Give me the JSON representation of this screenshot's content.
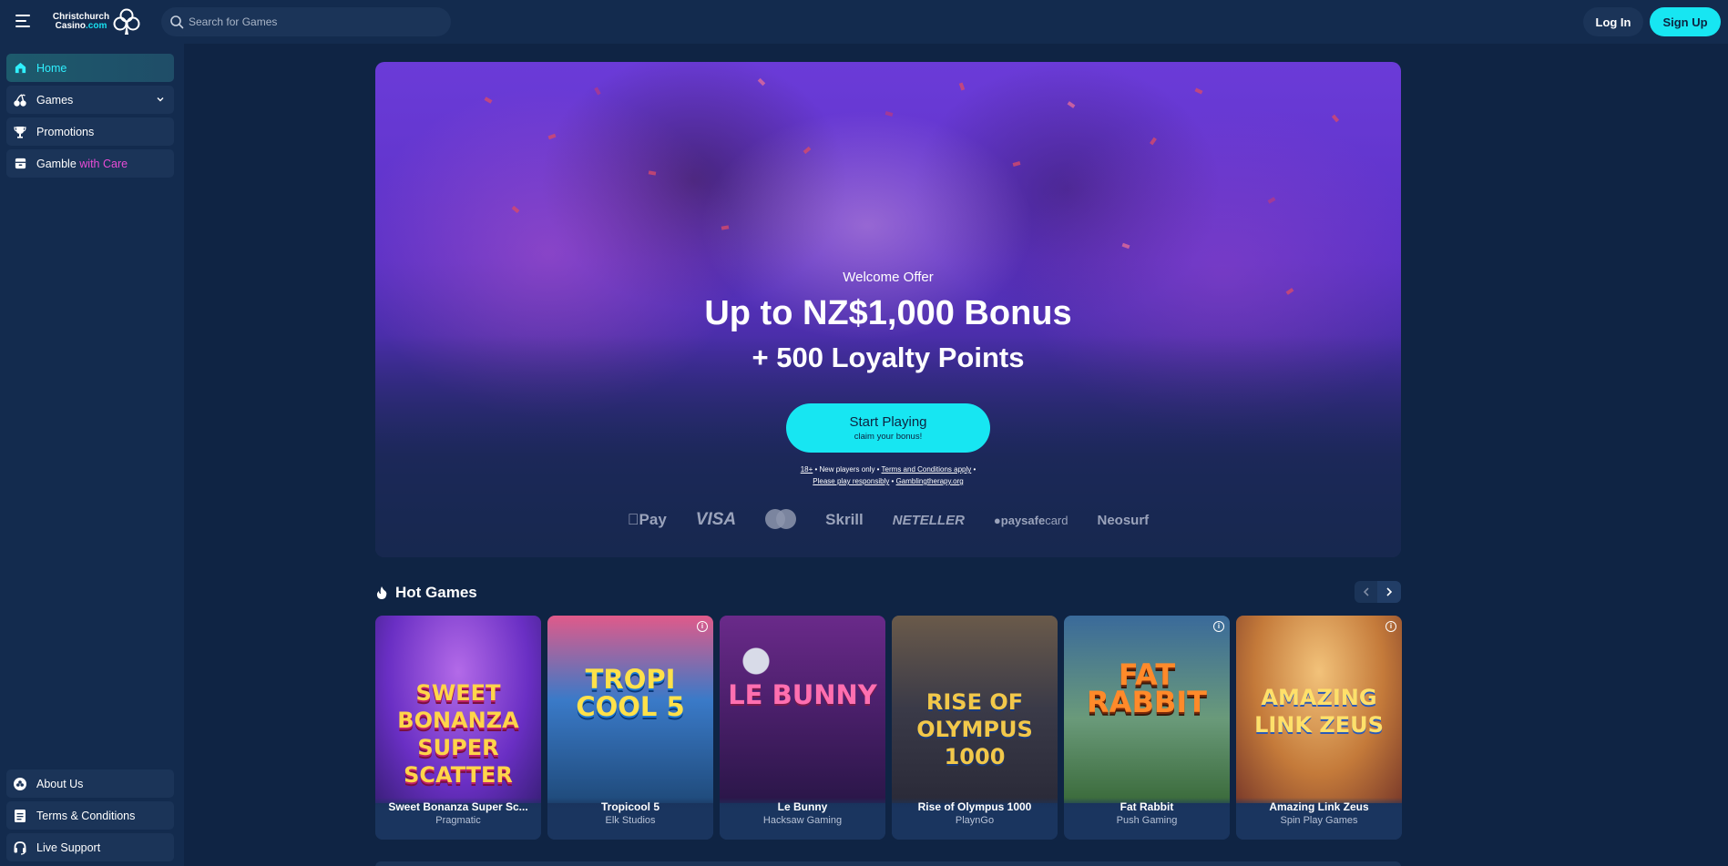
{
  "header": {
    "logo_line1": "Christchurch",
    "logo_line2": "Casino",
    "logo_domain": ".com",
    "search_placeholder": "Search for Games",
    "login_label": "Log In",
    "signup_label": "Sign Up"
  },
  "sidebar": {
    "top_items": [
      {
        "label": "Home",
        "icon": "home-icon",
        "active": true
      },
      {
        "label": "Games",
        "icon": "cherries-icon",
        "active": false
      },
      {
        "label": "Promotions",
        "icon": "trophy-icon",
        "active": false
      },
      {
        "label": "Gamble",
        "label_accent": "with Care",
        "icon": "archive-icon",
        "active": false
      }
    ],
    "bottom_items": [
      {
        "label": "About Us",
        "icon": "club-icon"
      },
      {
        "label": "Terms & Conditions",
        "icon": "document-icon"
      },
      {
        "label": "Live Support",
        "icon": "headset-icon"
      }
    ]
  },
  "banner": {
    "welcome": "Welcome Offer",
    "headline": "Up to NZ$1,000 Bonus",
    "subline": "+ 500 Loyalty Points",
    "cta_title": "Start Playing",
    "cta_sub": "claim your bonus!",
    "terms_age": "18+",
    "terms_new": " • New players only • ",
    "terms_link": "Terms and Conditions apply",
    "terms_sep": " •",
    "terms_responsible": "Please play responsibly",
    "terms_dot": " • ",
    "terms_therapy": "Gamblingtherapy.org",
    "payments": [
      "Pay",
      "VISA",
      "Skrill",
      "NETELLER",
      "paysafe",
      "card",
      "Neosurf"
    ],
    "mastercard_caption": "mastercard"
  },
  "hot_games": {
    "title": "Hot Games",
    "games": [
      {
        "name": "Sweet Bonanza Super Sc...",
        "provider": "Pragmatic",
        "art_text": "SWEET BONANZA SUPER SCATTER",
        "info": false
      },
      {
        "name": "Tropicool 5",
        "provider": "Elk Studios",
        "art_text": "TROPI COOL 5",
        "info": true
      },
      {
        "name": "Le Bunny",
        "provider": "Hacksaw Gaming",
        "art_text": "LE BUNNY",
        "info": false
      },
      {
        "name": "Rise of Olympus 1000",
        "provider": "PlaynGo",
        "art_text": "RISE OF OLYMPUS 1000",
        "info": false
      },
      {
        "name": "Fat Rabbit",
        "provider": "Push Gaming",
        "art_text": "FAT RABBIT",
        "info": true
      },
      {
        "name": "Amazing Link Zeus",
        "provider": "Spin Play Games",
        "art_text": "AMAZING LINK ZEUS",
        "info": true
      }
    ]
  },
  "colors": {
    "background": "#0f2444",
    "panel": "#132b4e",
    "accent": "#17e6f2",
    "care_accent": "#e84cd6"
  }
}
